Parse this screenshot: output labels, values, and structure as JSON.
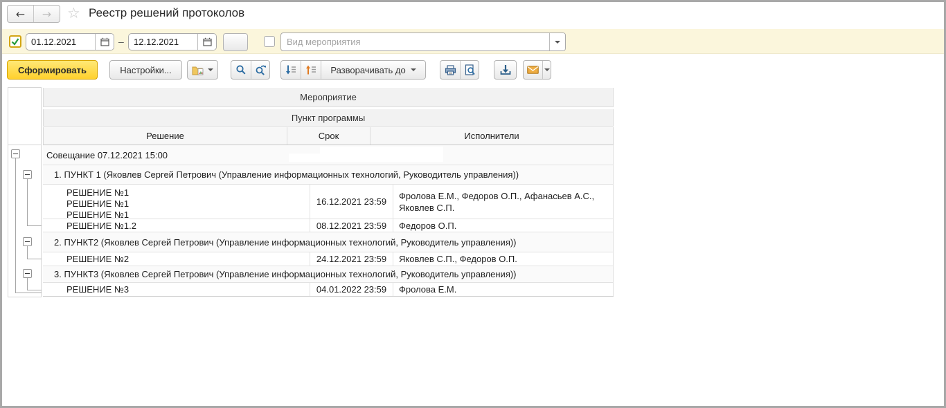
{
  "window": {
    "title": "Реестр решений протоколов"
  },
  "header": {
    "back_icon": "left-arrow",
    "forward_icon": "right-arrow",
    "favorite_icon": "star-outline"
  },
  "filters": {
    "period_checkbox_checked": true,
    "date_from": "01.12.2021",
    "range_dash": "–",
    "date_to": "12.12.2021",
    "event_type_checkbox_checked": false,
    "event_type_placeholder": "Вид мероприятия"
  },
  "toolbar": {
    "generate_label": "Сформировать",
    "settings_label": "Настройки...",
    "expand_to_label": "Разворачивать до",
    "icons": [
      "report-variants-icon",
      "search-icon",
      "search-repeat-icon",
      "expand-all-icon",
      "collapse-all-icon",
      "print-icon",
      "print-preview-icon",
      "save-icon",
      "email-icon"
    ]
  },
  "table": {
    "headers": {
      "event": "Мероприятие",
      "program_item": "Пункт программы",
      "decision": "Решение",
      "deadline": "Срок",
      "executors": "Исполнители"
    },
    "rows": [
      {
        "type": "meeting-group",
        "text": "Совещание 07.12.2021 15:00",
        "redacted_area": true
      },
      {
        "type": "item-group",
        "text": "1. ПУНКТ 1 (Яковлев Сергей Петрович (Управление информационных технологий, Руководитель управления))"
      },
      {
        "type": "decision",
        "lines": [
          "РЕШЕНИЕ №1",
          "РЕШЕНИЕ №1",
          "РЕШЕНИЕ №1"
        ],
        "deadline": "16.12.2021 23:59",
        "executors": "Фролова Е.М., Федоров О.П., Афанасьев А.С., Яковлев С.П."
      },
      {
        "type": "decision",
        "lines": [
          "РЕШЕНИЕ №1.2"
        ],
        "deadline": "08.12.2021 23:59",
        "executors": "Федоров О.П."
      },
      {
        "type": "item-group",
        "text": "2. ПУНКТ2 (Яковлев Сергей Петрович (Управление информационных технологий, Руководитель управления))"
      },
      {
        "type": "decision",
        "lines": [
          "РЕШЕНИЕ №2"
        ],
        "deadline": "24.12.2021 23:59",
        "executors": "Яковлев С.П., Федоров О.П."
      },
      {
        "type": "item-group",
        "text": "3. ПУНКТ3 (Яковлев Сергей Петрович (Управление информационных технологий, Руководитель управления))"
      },
      {
        "type": "decision",
        "lines": [
          "РЕШЕНИЕ №3"
        ],
        "deadline": "04.01.2022 23:59",
        "executors": "Фролова Е.М."
      }
    ]
  },
  "colors": {
    "filter_bar_bg": "#fbf6dc",
    "generate_button_bg": "#ffd12d",
    "checkbox_check": "#259b3e",
    "icon_blue": "#2d6da3",
    "icon_orange": "#e0791f",
    "envelope_yellow": "#eead43",
    "folder_yellow": "#f0c75e",
    "header_band_bg": "#f2f2f2",
    "group_row_bg": "#fafafa",
    "grid_border": "#e2e2e2"
  }
}
